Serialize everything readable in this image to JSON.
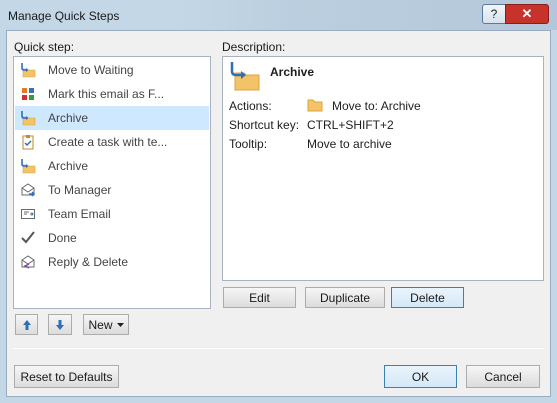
{
  "window": {
    "title": "Manage Quick Steps",
    "help_label": "?",
    "close_label": "✕"
  },
  "quick_step_label": "Quick step:",
  "description_label": "Description:",
  "quick_steps": [
    {
      "label": "Move to Waiting",
      "icon": "folder-move-icon"
    },
    {
      "label": "Mark this email as F...",
      "icon": "categorize-icon"
    },
    {
      "label": "Archive",
      "icon": "folder-move-icon",
      "selected": true
    },
    {
      "label": "Create a task with te...",
      "icon": "task-icon"
    },
    {
      "label": "Archive",
      "icon": "folder-move-icon"
    },
    {
      "label": "To Manager",
      "icon": "forward-mail-icon"
    },
    {
      "label": "Team Email",
      "icon": "envelope-icon"
    },
    {
      "label": "Done",
      "icon": "checkmark-icon"
    },
    {
      "label": "Reply & Delete",
      "icon": "reply-delete-icon"
    }
  ],
  "description": {
    "title": "Archive",
    "actions_label": "Actions:",
    "actions_value": "Move to: Archive",
    "shortcut_label": "Shortcut key:",
    "shortcut_value": "CTRL+SHIFT+2",
    "tooltip_label": "Tooltip:",
    "tooltip_value": "Move to archive"
  },
  "buttons": {
    "edit": "Edit",
    "duplicate": "Duplicate",
    "delete": "Delete",
    "new": "New",
    "reset": "Reset to Defaults",
    "ok": "OK",
    "cancel": "Cancel"
  },
  "colors": {
    "selected_row": "#cde8ff",
    "accent_blue": "#2f6fb5",
    "close_red": "#c7322b"
  }
}
